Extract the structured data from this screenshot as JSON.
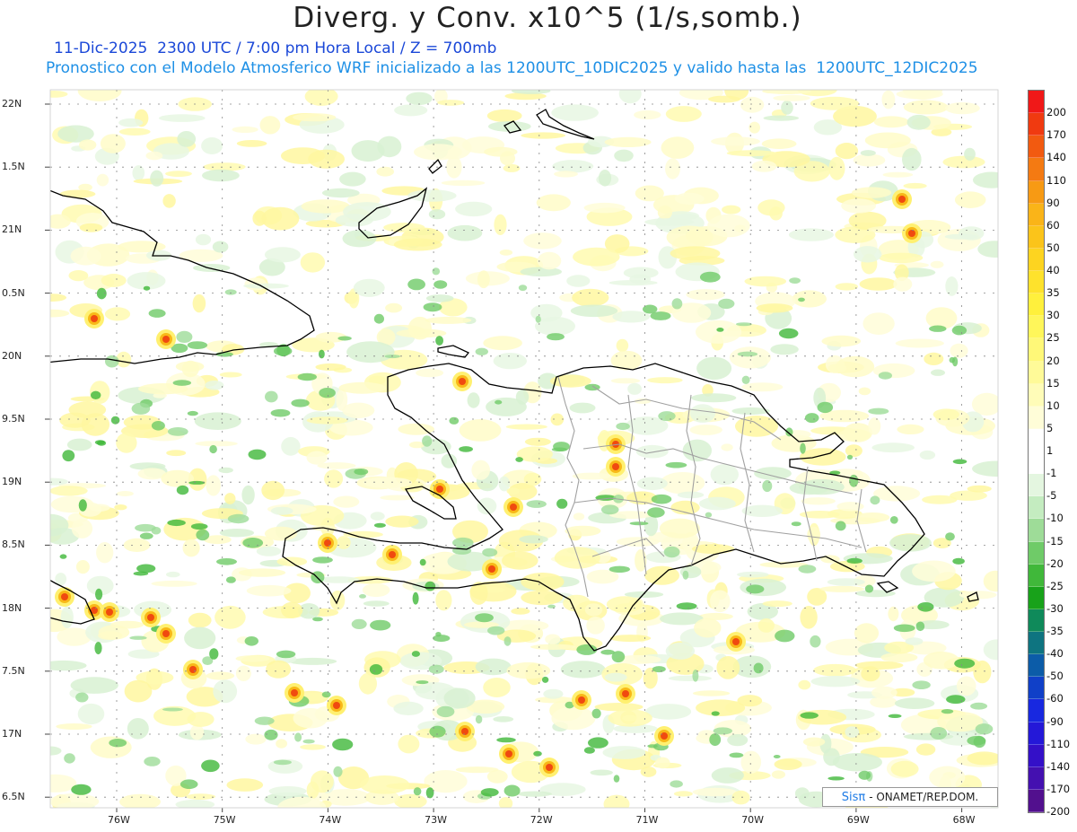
{
  "title": "Diverg. y Conv. x10^5 (1/s,somb.)",
  "subtitle": "11-Dic-2025  2300 UTC / 7:00 pm Hora Local / Z = 700mb",
  "subtitle2": "Pronostico con el Modelo Atmosferico WRF inicializado a las 1200UTC_10DIC2025 y valido hasta las  1200UTC_12DIC2025",
  "lat_labels": [
    "22N",
    "1.5N",
    "21N",
    "0.5N",
    "20N",
    "9.5N",
    "19N",
    "8.5N",
    "18N",
    "7.5N",
    "17N",
    "6.5N"
  ],
  "lon_labels": [
    "76W",
    "75W",
    "74W",
    "73W",
    "72W",
    "71W",
    "70W",
    "69W",
    "68W"
  ],
  "colorbar": {
    "labels": [
      "200",
      "170",
      "140",
      "110",
      "90",
      "60",
      "50",
      "40",
      "35",
      "30",
      "25",
      "20",
      "15",
      "10",
      "5",
      "1",
      "-1",
      "-5",
      "-10",
      "-15",
      "-20",
      "-25",
      "-30",
      "-35",
      "-40",
      "-50",
      "-60",
      "-90",
      "-110",
      "-140",
      "-170",
      "-200"
    ],
    "colors": [
      "#f01818",
      "#f03a10",
      "#f25a10",
      "#f47a12",
      "#f79a14",
      "#fab418",
      "#fbc41a",
      "#fdd420",
      "#fee22c",
      "#fff03c",
      "#fff65a",
      "#fff878",
      "#fffa98",
      "#fffcb8",
      "#fffdd8",
      "#ffffff",
      "#ffffff",
      "#e4f6e0",
      "#c4ecc0",
      "#9edc98",
      "#6fcb68",
      "#40b83a",
      "#18a21a",
      "#0f8a5a",
      "#0e7480",
      "#0c5ca8",
      "#1040c8",
      "#1828e0",
      "#2418d8",
      "#3410c8",
      "#4410b0",
      "#52108e"
    ]
  },
  "credit": {
    "sis": "Sisπ",
    "text": "- ONAMET/REP.DOM."
  },
  "colors": {
    "coast": "#000000",
    "provinces": "#a0a0a0",
    "grid": "#888888"
  }
}
